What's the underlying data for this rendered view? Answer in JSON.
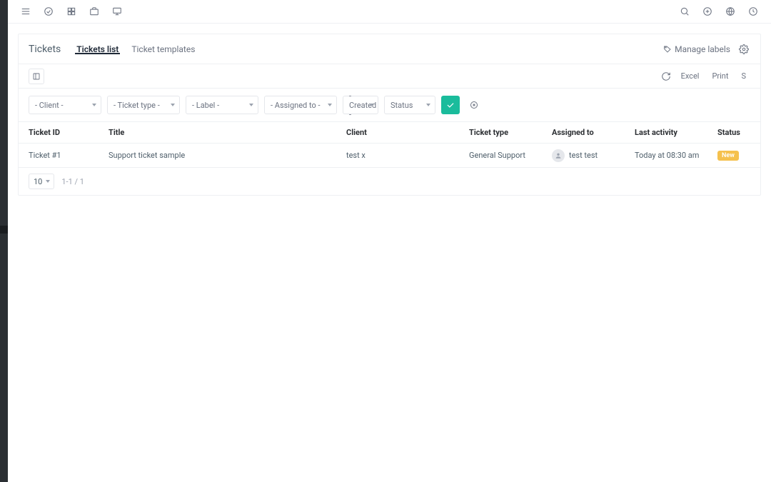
{
  "page": {
    "title": "Tickets"
  },
  "tabs": {
    "list": "Tickets list",
    "templates": "Ticket templates"
  },
  "header": {
    "manage_labels": "Manage labels"
  },
  "toolbar": {
    "excel": "Excel",
    "print": "Print",
    "s": "S"
  },
  "filters": {
    "client": "- Client -",
    "ticket_type": "- Ticket type -",
    "label": "- Label -",
    "assigned_to": "- Assigned to -",
    "created": "- Created -",
    "status": "Status"
  },
  "columns": {
    "ticket_id": "Ticket ID",
    "title": "Title",
    "client": "Client",
    "ticket_type": "Ticket type",
    "assigned_to": "Assigned to",
    "last_activity": "Last activity",
    "status": "Status"
  },
  "rows": [
    {
      "id": "Ticket #1",
      "title": "Support ticket sample",
      "client": "test x",
      "type": "General Support",
      "assigned": "test test",
      "activity": "Today at 08:30 am",
      "status": "New"
    }
  ],
  "pagination": {
    "size": "10",
    "info": "1-1 / 1"
  }
}
